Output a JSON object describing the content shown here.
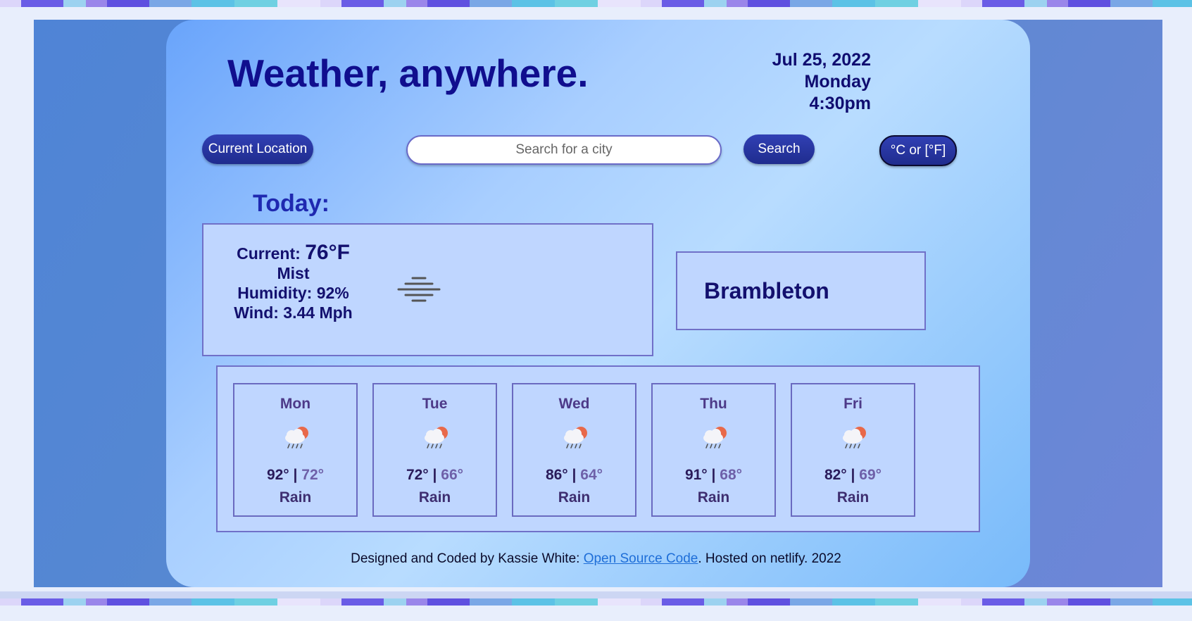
{
  "header": {
    "title": "Weather, anywhere.",
    "date": "Jul 25, 2022",
    "weekday": "Monday",
    "time": "4:30pm"
  },
  "controls": {
    "current_location_label": "Current Location",
    "search_placeholder": "Search for a city",
    "search_value": "",
    "search_label": "Search",
    "unit_toggle_label": "°C or [°F]"
  },
  "today": {
    "label": "Today:",
    "current_prefix": "Current:",
    "temperature": "76°F",
    "condition": "Mist",
    "humidity": "Humidity: 92%",
    "wind": "Wind: 3.44 Mph",
    "icon": "mist-icon"
  },
  "city": {
    "name": "Brambleton"
  },
  "forecast": [
    {
      "day": "Mon",
      "high": "92°",
      "low": "72°",
      "desc": "Rain",
      "icon": "rain-sun-cloud-icon"
    },
    {
      "day": "Tue",
      "high": "72°",
      "low": "66°",
      "desc": "Rain",
      "icon": "rain-sun-cloud-icon"
    },
    {
      "day": "Wed",
      "high": "86°",
      "low": "64°",
      "desc": "Rain",
      "icon": "rain-sun-cloud-icon"
    },
    {
      "day": "Thu",
      "high": "91°",
      "low": "68°",
      "desc": "Rain",
      "icon": "rain-sun-cloud-icon"
    },
    {
      "day": "Fri",
      "high": "82°",
      "low": "69°",
      "desc": "Rain",
      "icon": "rain-sun-cloud-icon"
    }
  ],
  "footer": {
    "prefix": "Designed and Coded by Kassie White: ",
    "link_text": "Open Source Code",
    "suffix": ". Hosted on netlify. 2022"
  },
  "colors": {
    "title": "#100e8e",
    "button": "#2535a0",
    "panel": "#bfd6ff",
    "link": "#1e6ed8"
  }
}
